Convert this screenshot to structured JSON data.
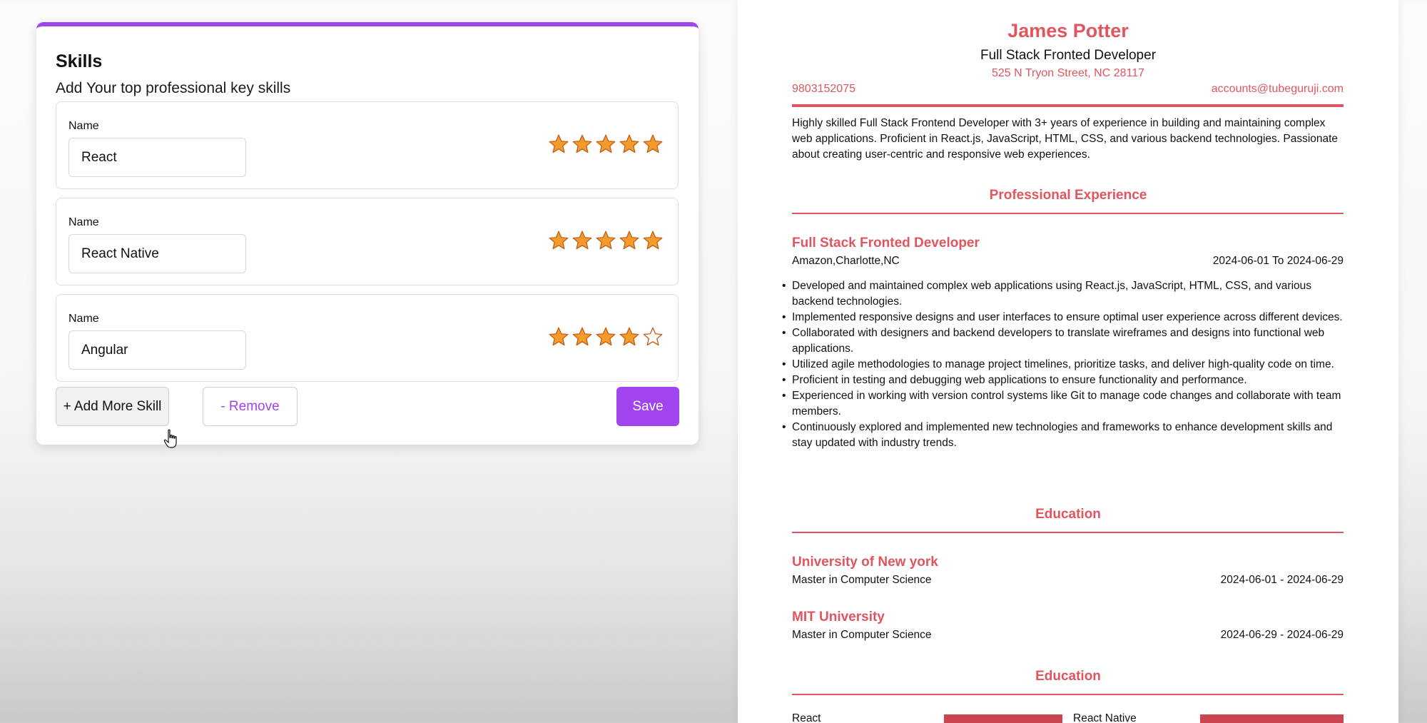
{
  "form": {
    "title": "Skills",
    "subtitle": "Add Your top professional key skills",
    "skills": [
      {
        "label": "Name",
        "value": "React",
        "rating": 5
      },
      {
        "label": "Name",
        "value": "React Native",
        "rating": 5
      },
      {
        "label": "Name",
        "value": "Angular",
        "rating": 4
      }
    ],
    "add_label": "+ Add More Skill",
    "remove_label": "- Remove",
    "save_label": "Save",
    "max_rating": 5
  },
  "resume": {
    "name": "James Potter",
    "job_title": "Full Stack Fronted Developer",
    "address": "525 N Tryon Street, NC 28117",
    "phone": "9803152075",
    "email": "accounts@tubeguruji.com",
    "summary": "Highly skilled Full Stack Frontend Developer with 3+ years of experience in building and maintaining complex web applications. Proficient in React.js, JavaScript, HTML, CSS, and various backend technologies. Passionate about creating user-centric and responsive web experiences.",
    "experience_heading": "Professional Experience",
    "experience": {
      "title": "Full Stack Fronted Developer",
      "company": "Amazon,Charlotte,NC",
      "dates": "2024-06-01 To 2024-06-29",
      "bullets": [
        "Developed and maintained complex web applications using React.js, JavaScript, HTML, CSS, and various backend technologies.",
        "Implemented responsive designs and user interfaces to ensure optimal user experience across different devices.",
        "Collaborated with designers and backend developers to translate wireframes and designs into functional web applications.",
        "Utilized agile methodologies to manage project timelines, prioritize tasks, and deliver high-quality code on time.",
        "Proficient in testing and debugging web applications to ensure functionality and performance.",
        "Experienced in working with version control systems like Git to manage code changes and collaborate with team members.",
        "Continuously explored and implemented new technologies and frameworks to enhance development skills and stay updated with industry trends."
      ]
    },
    "education_heading": "Education",
    "education": [
      {
        "school": "University of New york",
        "degree": "Master in Computer Science",
        "dates": "2024-06-01 - 2024-06-29"
      },
      {
        "school": "MIT University",
        "degree": "Master in Computer Science",
        "dates": "2024-06-29 - 2024-06-29"
      }
    ],
    "skills_heading": "Education",
    "skills": [
      {
        "name": "React"
      },
      {
        "name": "React Native"
      }
    ]
  },
  "colors": {
    "accent_purple": "#9f44ee",
    "resume_red": "#e0565f",
    "star_fill": "#f59b2b",
    "star_stroke": "#c2621a"
  }
}
